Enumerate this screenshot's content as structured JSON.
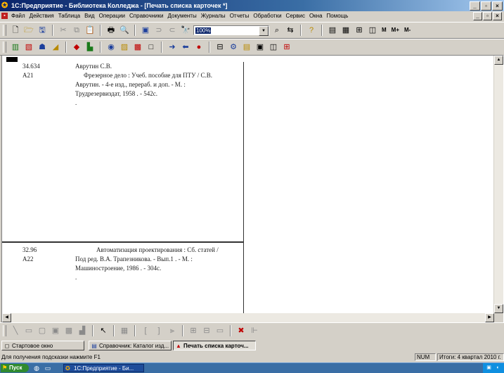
{
  "window": {
    "title": "1С:Предприятие - Библиотека Колледжа - [Печать списка карточек *]",
    "app_icon": "1c-app-icon",
    "buttons": [
      "_",
      "▫",
      "×"
    ]
  },
  "menu": {
    "items": [
      "Файл",
      "Действия",
      "Таблица",
      "Вид",
      "Операции",
      "Справочники",
      "Документы",
      "Журналы",
      "Отчеты",
      "Обработки",
      "Сервис",
      "Окна",
      "Помощь"
    ],
    "doc_icon": "document-icon"
  },
  "toolbar": {
    "zoom_value": "100%",
    "text_buttons": [
      "M",
      "M+",
      "M-"
    ]
  },
  "cards": [
    {
      "code_line1": "34.634",
      "code_line2": "А21",
      "author": "Аврутин С.В.",
      "text": "Фрезерное дело : Учеб. пособие для ПТУ / С.В. Аврутин. - 4-е изд., перераб. и доп. - М. : Трудрезервиздат, 1958 . - 542с.",
      "tail": "."
    },
    {
      "code_line1": "32.96",
      "code_line2": "А22",
      "author": "",
      "text": "Автоматизация проектирования : Сб. статей / Под ред. В.А. Трапезникова. - Вып.1 . - М. : Машиностроение, 1986 . - 304с.",
      "tail": "."
    }
  ],
  "window_tabs": [
    {
      "label": "Стартовое окно",
      "icon": "window-icon",
      "active": false
    },
    {
      "label": "Справочник: Каталог изд...",
      "icon": "catalog-icon",
      "active": false
    },
    {
      "label": "Печать списка карточ...",
      "icon": "print-doc-icon",
      "active": true
    }
  ],
  "status": {
    "hint": "Для получения подсказки нажмите F1",
    "num": "NUM",
    "totals": "Итоги: 4 квартал 2010 г."
  },
  "taskbar": {
    "start_label": "Пуск",
    "task_label": "1С:Предприятие - Би..."
  }
}
